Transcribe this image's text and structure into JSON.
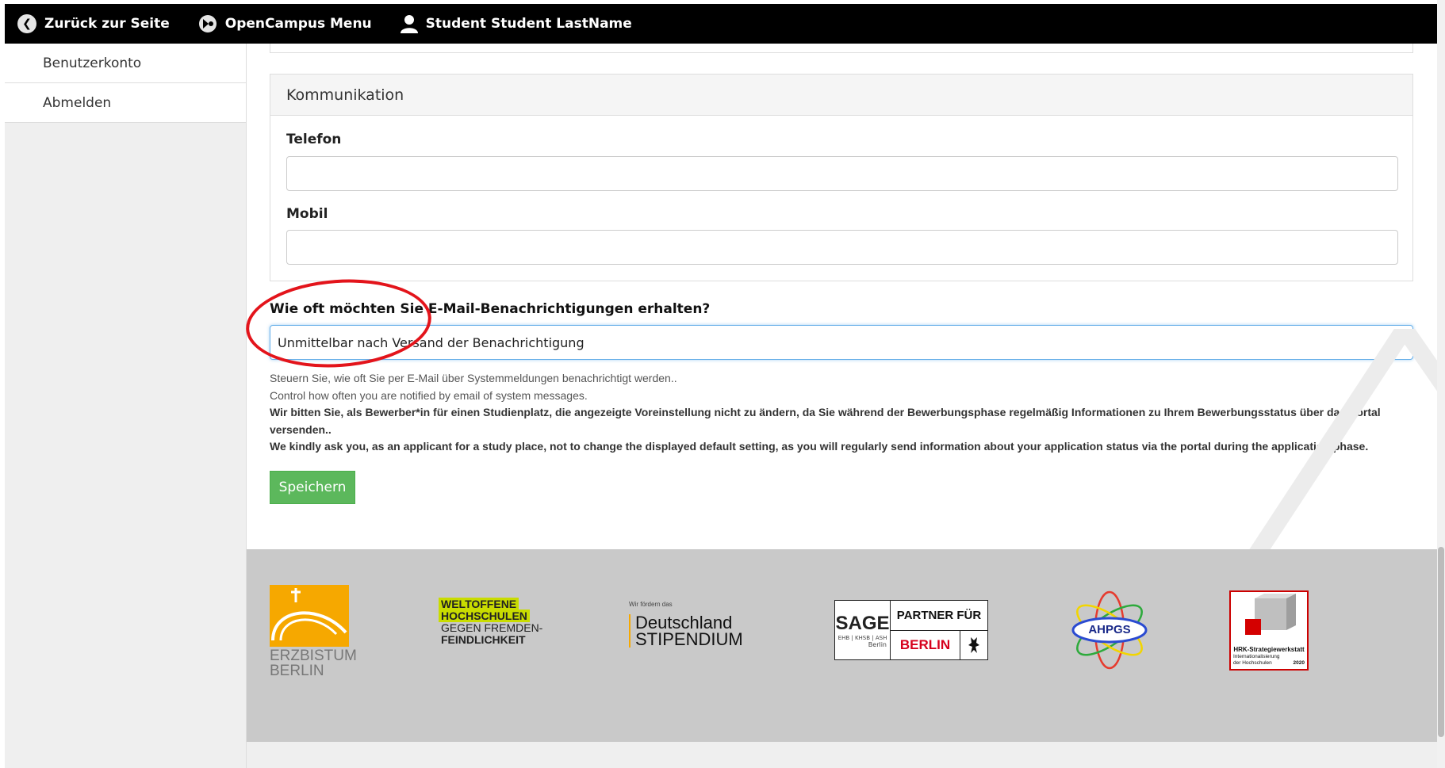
{
  "topbar": {
    "back_label": "Zurück zur Seite",
    "menu_label": "OpenCampus Menu",
    "user_label": "Student Student LastName"
  },
  "sidebar": {
    "items": [
      {
        "label": "Benutzerkonto"
      },
      {
        "label": "Abmelden"
      }
    ]
  },
  "kommunikation": {
    "title": "Kommunikation",
    "telefon_label": "Telefon",
    "telefon_value": "",
    "mobil_label": "Mobil",
    "mobil_value": ""
  },
  "notifications": {
    "question": "Wie oft möchten Sie E-Mail-Benachrichtigungen erhalten?",
    "selected": "Unmittelbar nach Versand der Benachrichtigung",
    "help_de": "Steuern Sie, wie oft Sie per E-Mail über Systemmeldungen benachrichtigt werden..",
    "help_en": "Control how often you are notified by email of system messages.",
    "note_de": "Wir bitten Sie, als Bewerber*in für einen Studienplatz, die angezeigte Voreinstellung nicht zu ändern, da Sie während der Bewerbungsphase regelmäßig Informationen zu Ihrem Bewerbungsstatus über das Portal versenden..",
    "note_en": "We kindly ask you, as an applicant for a study place, not to change the displayed default setting, as you will regularly send information about your application status via the portal during the application phase."
  },
  "save_label": "Speichern",
  "footer": {
    "erzbistum": [
      "ERZBISTUM",
      "BERLIN"
    ],
    "weltoffene": [
      "WELTOFFENE",
      "HOCHSCHULEN",
      "GEGEN FREMDEN-",
      "FEINDLICHKEIT"
    ],
    "ds_small": "Wir fördern das",
    "ds_main": [
      "Deutschland",
      "STIPENDIUM"
    ],
    "sage": {
      "title": "SAGE",
      "sub": "EHB | KHSB | ASH",
      "city": "Berlin",
      "partner": "PARTNER FÜR",
      "berlin": "BERLIN"
    },
    "ahpgs": "AHPGS",
    "hrk": {
      "title": "HRK-Strategiewerkstatt",
      "line2": "Internationalisierung",
      "line3": "der Hochschulen",
      "year": "2020"
    }
  },
  "colors": {
    "accent_green": "#5cb85c",
    "annotation_red": "#e3141b",
    "topbar_bg": "#000000",
    "footer_bg": "#c9c9c9"
  },
  "icons": {
    "back": "chevron-left-circle-icon",
    "menu": "opencampus-logo-icon",
    "user": "user-icon",
    "select": "chevron-down-icon"
  }
}
